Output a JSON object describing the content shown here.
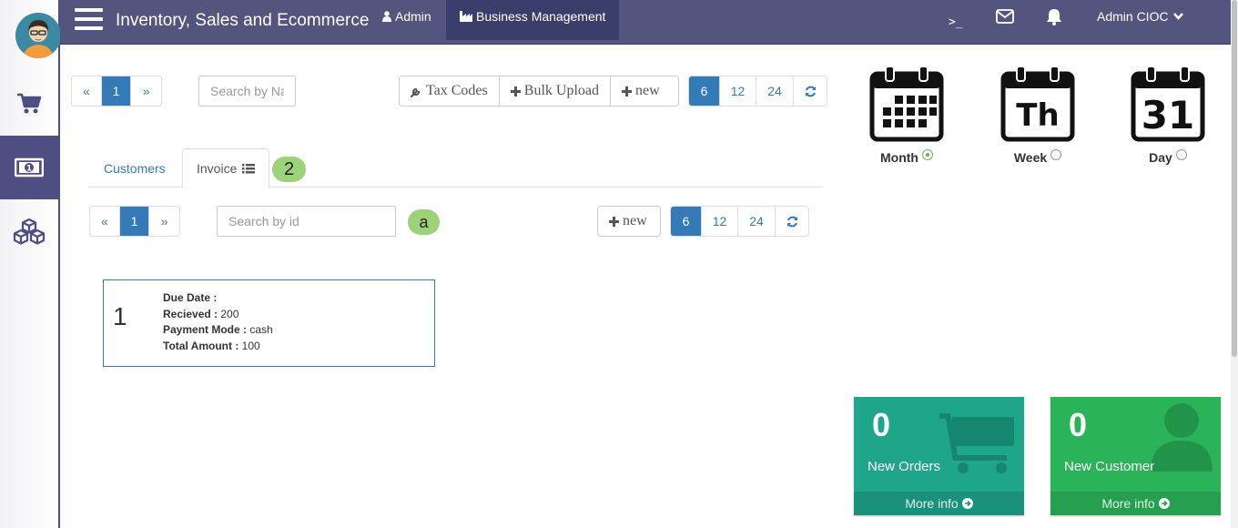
{
  "header": {
    "app_title": "Inventory, Sales and Ecommerce",
    "nav_admin": "Admin",
    "nav_business": "Business Management",
    "terminal_glyph": ">_",
    "user_name": "Admin CIOC"
  },
  "sidebar": {
    "items": [
      {
        "name": "cart-icon",
        "active": false
      },
      {
        "name": "money-icon",
        "active": true
      },
      {
        "name": "cubes-icon",
        "active": false
      }
    ]
  },
  "toolbar_top": {
    "pager": {
      "prev": "«",
      "page": "1",
      "next": "»"
    },
    "search_placeholder": "Search by Na",
    "buttons": {
      "tax_codes": "Tax Codes",
      "bulk_upload": "Bulk Upload",
      "new": "new"
    },
    "page_sizes": [
      "6",
      "12",
      "24"
    ],
    "active_size": "6"
  },
  "tabs": {
    "customers": "Customers",
    "invoice": "Invoice",
    "badge": "2"
  },
  "toolbar_invoice": {
    "pager": {
      "prev": "«",
      "page": "1",
      "next": "»"
    },
    "search_placeholder": "Search by id",
    "badge": "a",
    "new": "new",
    "page_sizes": [
      "6",
      "12",
      "24"
    ],
    "active_size": "6"
  },
  "invoice_card": {
    "number": "1",
    "due_date_label": "Due Date :",
    "due_date_value": "",
    "received_label": "Recieved :",
    "received_value": "200",
    "payment_mode_label": "Payment Mode :",
    "payment_mode_value": "cash",
    "total_amount_label": "Total Amount :",
    "total_amount_value": "100"
  },
  "calendar": {
    "month_label": "Month",
    "week_label": "Week",
    "week_glyph": "Th",
    "day_label": "Day",
    "day_glyph": "31",
    "selected": "Month"
  },
  "stats": {
    "orders": {
      "count": "0",
      "label": "New Orders",
      "more": "More info",
      "color": "#1fa58a"
    },
    "customers": {
      "count": "0",
      "label": "New Customer",
      "more": "More info",
      "color": "#2bb35a"
    }
  },
  "colors": {
    "topbar": "#53557f",
    "primary": "#337ab7",
    "badge": "#9bd27a"
  }
}
